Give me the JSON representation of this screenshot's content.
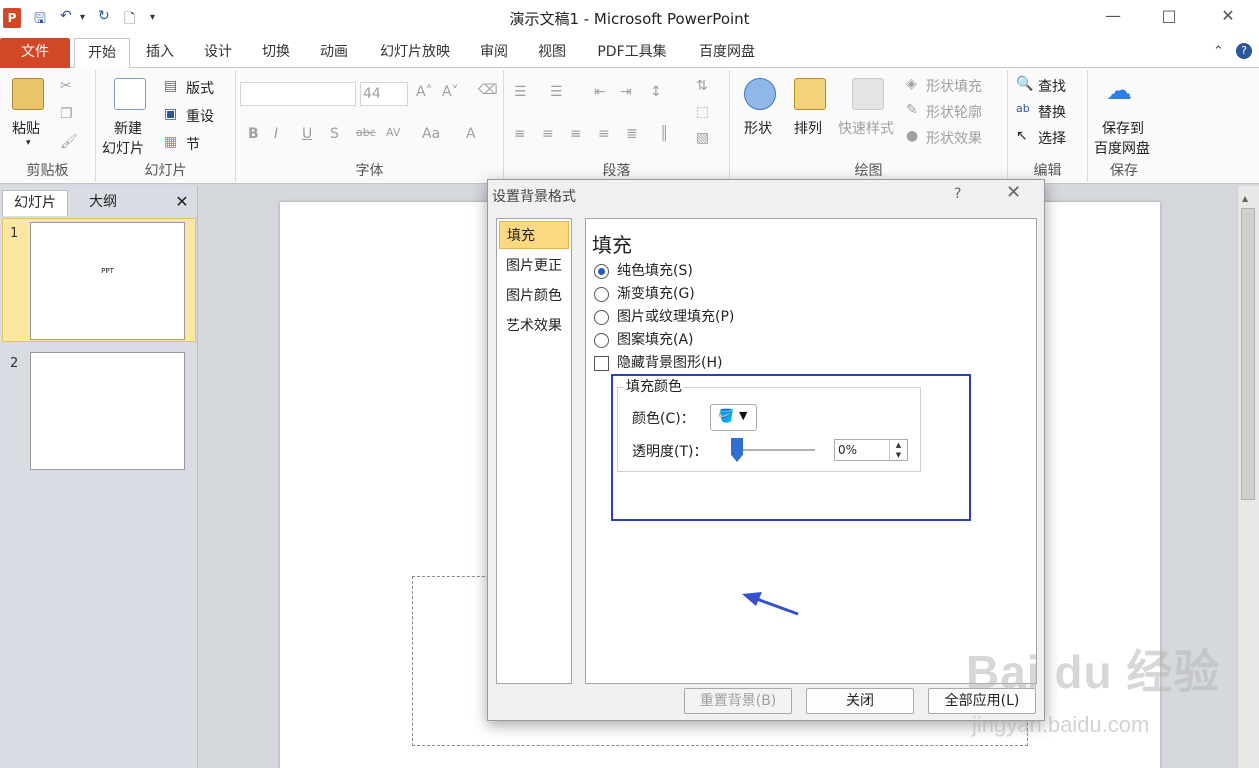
{
  "window": {
    "title": "演示文稿1 - Microsoft PowerPoint",
    "app_icon": "P"
  },
  "tabs": [
    "文件",
    "开始",
    "插入",
    "设计",
    "切换",
    "动画",
    "幻灯片放映",
    "审阅",
    "视图",
    "PDF工具集",
    "百度网盘"
  ],
  "ribbon": {
    "clipboard": {
      "paste": "粘贴",
      "label": "剪贴板"
    },
    "slides": {
      "new_slide_1": "新建",
      "new_slide_2": "幻灯片",
      "layout": "版式",
      "reset": "重设",
      "section": "节",
      "label": "幻灯片"
    },
    "font": {
      "font_size": "44",
      "label": "字体"
    },
    "paragraph": {
      "label": "段落"
    },
    "drawing": {
      "shapes": "形状",
      "arrange": "排列",
      "quick_styles": "快速样式",
      "shape_fill": "形状填充",
      "shape_outline": "形状轮廓",
      "shape_effects": "形状效果",
      "label": "绘图"
    },
    "editing": {
      "find": "查找",
      "replace": "替换",
      "select": "选择",
      "label": "编辑"
    },
    "save": {
      "save_1": "保存到",
      "save_2": "百度网盘",
      "label": "保存"
    }
  },
  "pane": {
    "tab_slides": "幻灯片",
    "tab_outline": "大纲",
    "close": "✕",
    "slides": [
      {
        "num": "1",
        "text": "PPT"
      },
      {
        "num": "2",
        "text": ""
      }
    ]
  },
  "dialog": {
    "title": "设置背景格式",
    "help": "?",
    "close": "✕",
    "nav": [
      "填充",
      "图片更正",
      "图片颜色",
      "艺术效果"
    ],
    "heading": "填充",
    "options": [
      {
        "label": "纯色填充(S)",
        "selected": true
      },
      {
        "label": "渐变填充(G)",
        "selected": false
      },
      {
        "label": "图片或纹理填充(P)",
        "selected": false
      },
      {
        "label": "图案填充(A)",
        "selected": false
      }
    ],
    "hide_bg": "隐藏背景图形(H)",
    "fill_color_group": "填充颜色",
    "color_label": "颜色(C)：",
    "transparency_label": "透明度(T)：",
    "transparency_value": "0%",
    "transparency": 0,
    "buttons": {
      "reset": "重置背景(B)",
      "close": "关闭",
      "apply_all": "全部应用(L)"
    }
  },
  "watermark": {
    "brand": "Bai du 经验",
    "url": "jingyan.baidu.com"
  },
  "colors": {
    "accent": "#d24726",
    "selection": "#fbd982",
    "highlight": "#2f3ebd"
  }
}
